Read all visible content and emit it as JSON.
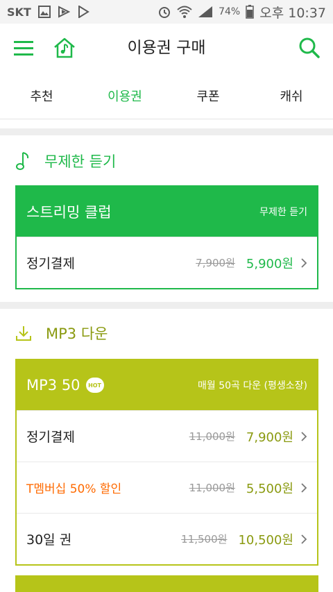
{
  "status_bar": {
    "carrier": "SKT",
    "battery": "74%",
    "time": "오후 10:37"
  },
  "header": {
    "title": "이용권 구매",
    "icons": [
      "menu-icon",
      "home-music-icon",
      "search-icon"
    ]
  },
  "tabs": [
    {
      "label": "추천",
      "active": false
    },
    {
      "label": "이용권",
      "active": true
    },
    {
      "label": "쿠폰",
      "active": false
    },
    {
      "label": "캐쉬",
      "active": false
    }
  ],
  "colors": {
    "accent_green": "#1fb94a",
    "accent_olive": "#b6c419",
    "promo_orange": "#ff6a00"
  },
  "sections": [
    {
      "title": "무제한 듣기",
      "icon": "music-note-icon",
      "cards": [
        {
          "name": "스트리밍 클럽",
          "subtitle": "무제한 듣기",
          "hot": false,
          "rows": [
            {
              "label": "정기결제",
              "original_price": "7,900원",
              "price": "5,900원",
              "promo": false
            }
          ]
        }
      ]
    },
    {
      "title": "MP3 다운",
      "icon": "download-icon",
      "cards": [
        {
          "name": "MP3 50",
          "subtitle": "매월 50곡 다운 (평생소장)",
          "hot": true,
          "hot_label": "HOT",
          "rows": [
            {
              "label": "정기결제",
              "original_price": "11,000원",
              "price": "7,900원",
              "promo": false
            },
            {
              "label": "T멤버십 50% 할인",
              "original_price": "11,000원",
              "price": "5,500원",
              "promo": true
            },
            {
              "label": "30일 권",
              "original_price": "11,500원",
              "price": "10,500원",
              "promo": false
            }
          ]
        }
      ]
    }
  ]
}
